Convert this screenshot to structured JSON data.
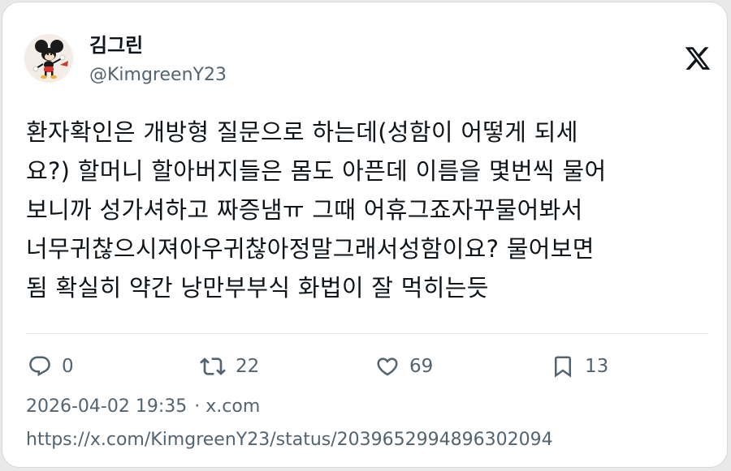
{
  "author": {
    "name": "김그린",
    "handle": "@KimgreenY23"
  },
  "logo": "x-logo-icon",
  "tweet": {
    "lines": [
      "환자확인은 개방형 질문으로 하는데(성함이 어떻게 되세",
      "요?) 할머니 할아버지들은 몸도 아픈데 이름을 몇번씩 물어",
      "보니까 성가셔하고 짜증냄ㅠ 그때 어휴그죠자꾸물어봐서",
      "너무귀찮으시져아우귀찮아정말그래서성함이요? 물어보면",
      "됨 확실히 약간 낭만부부식 화법이 잘 먹히는듯"
    ]
  },
  "actions": {
    "reply": {
      "icon": "reply-icon",
      "count": "0"
    },
    "retweet": {
      "icon": "retweet-icon",
      "count": "22"
    },
    "like": {
      "icon": "heart-icon",
      "count": "69"
    },
    "bookmark": {
      "icon": "bookmark-icon",
      "count": "13"
    }
  },
  "meta": {
    "timestamp": "2026-04-02 19:35",
    "separator": "·",
    "site": "x.com"
  },
  "url": "https://x.com/KimgreenY23/status/2039652994896302094",
  "colors": {
    "text": "#0f1419",
    "secondary": "#536471",
    "divider": "#e6e6e6",
    "background": "#ffffff"
  }
}
